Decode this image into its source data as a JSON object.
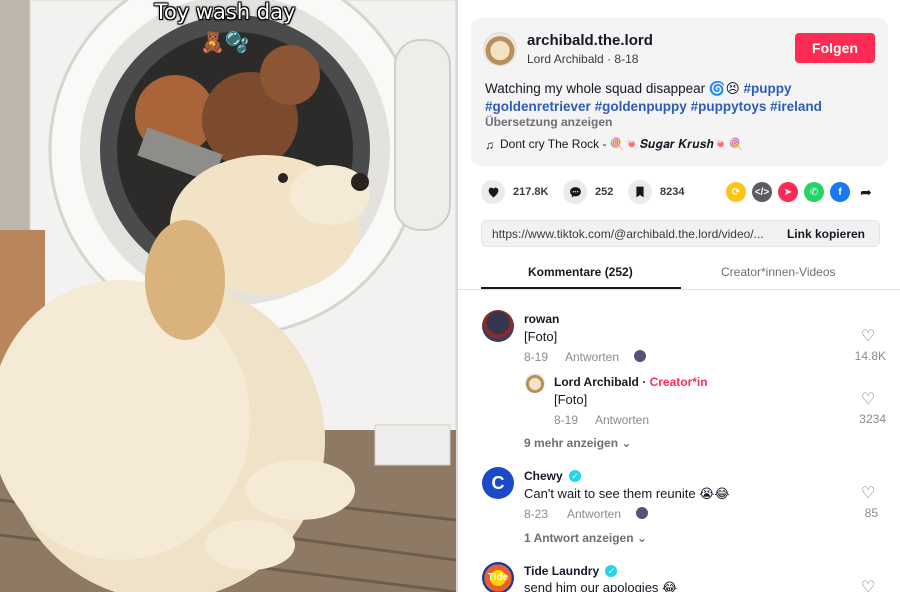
{
  "video": {
    "caption": "Toy wash day",
    "caption_emoji": "🧸🫧"
  },
  "post": {
    "username": "archibald.the.lord",
    "display_name": "Lord Archibald",
    "date": "8-18",
    "follow_label": "Folgen",
    "description_text": "Watching my whole squad disappear 🌀😣",
    "hashtags": [
      "#puppy",
      "#goldenretriever",
      "#goldenpuppy",
      "#puppytoys",
      "#ireland"
    ],
    "translate_label": "Übersetzung anzeigen",
    "music": "Dont cry The Rock - 🍭🍬𝑺𝒖𝒈𝒂𝒓 𝑲𝒓𝒖𝒔𝒉🍬🍭"
  },
  "actions": {
    "likes": "217.8K",
    "comments": "252",
    "saves": "8234",
    "share_icons": [
      "repost-icon",
      "embed-icon",
      "send-icon",
      "whatsapp-icon",
      "facebook-icon",
      "share-arrow-icon"
    ]
  },
  "link": {
    "url": "https://www.tiktok.com/@archibald.the.lord/video/...",
    "copy_label": "Link kopieren"
  },
  "tabs": {
    "comments": "Kommentare (252)",
    "creator_videos": "Creator*innen-Videos"
  },
  "comments": [
    {
      "name": "rowan",
      "text": "[Foto]",
      "date": "8-19",
      "reply_label": "Antworten",
      "likes": "14.8K",
      "reply": {
        "name": "Lord Archibald",
        "badge": "Creator*in",
        "text": "[Foto]",
        "date": "8-19",
        "reply_label": "Antworten",
        "likes": "3234"
      },
      "more_label": "9 mehr anzeigen"
    },
    {
      "name": "Chewy",
      "text": "Can't wait to see them reunite 😭😂",
      "date": "8-23",
      "reply_label": "Antworten",
      "likes": "85",
      "more_label": "1 Antwort anzeigen"
    },
    {
      "name": "Tide Laundry",
      "text": "send him our apologies 😂"
    }
  ],
  "colors": {
    "accent": "#fe2c55",
    "hashtag": "#2b5db9",
    "panel_bg": "#f4f4f5"
  }
}
